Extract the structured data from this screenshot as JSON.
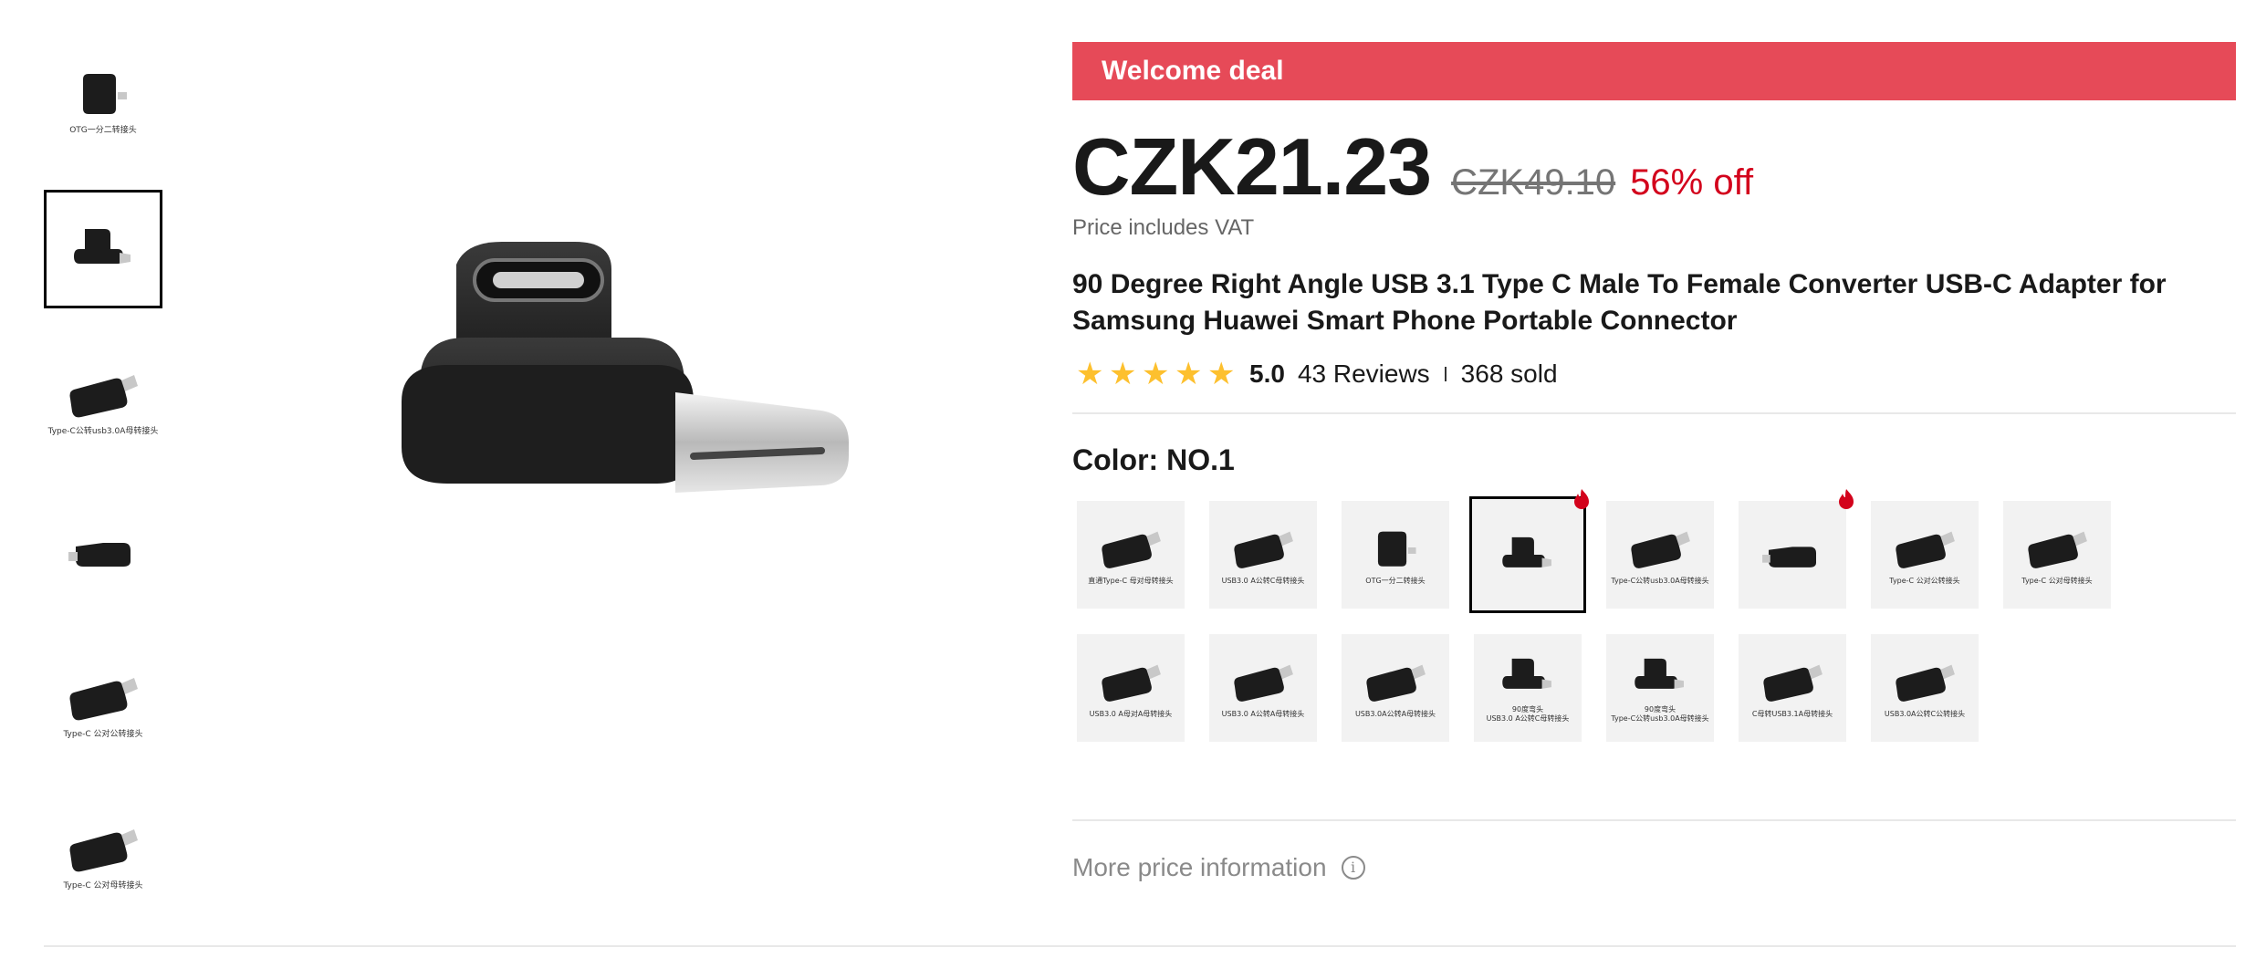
{
  "thumbnails": [
    {
      "caption": "OTG一分二转接头",
      "icon": "otg-splitter-adapter"
    },
    {
      "caption": "",
      "icon": "right-angle-type-c-adapter"
    },
    {
      "caption": "Type-C公转usb3.0A母转接头",
      "icon": "usb-a-female-adapter"
    },
    {
      "caption": "",
      "icon": "side-angle-adapter"
    },
    {
      "caption": "Type-C 公对公转接头",
      "icon": "type-c-male-male-adapter"
    },
    {
      "caption": "Type-C 公对母转接头",
      "icon": "type-c-male-female-adapter"
    }
  ],
  "active_thumbnail": 1,
  "deal": {
    "label": "Welcome deal",
    "color": "#e64a58"
  },
  "price": {
    "current": "CZK21.23",
    "original": "CZK49.10",
    "discount": "56% off",
    "vat_note": "Price includes VAT"
  },
  "product": {
    "title": "90 Degree Right Angle USB 3.1 Type C Male To Female Converter USB-C Adapter for Samsung Huawei Smart Phone Portable Connector"
  },
  "rating": {
    "stars": 5,
    "value": "5.0",
    "reviews": "43 Reviews",
    "sold": "368 sold"
  },
  "color": {
    "label": "Color: NO.1",
    "selected_index": 3,
    "options": [
      {
        "caption": "直通Type-C 母对母转接头",
        "hot": false
      },
      {
        "caption": "USB3.0 A公转C母转接头",
        "hot": false
      },
      {
        "caption": "OTG一分二转接头",
        "hot": false
      },
      {
        "caption": "",
        "hot": true
      },
      {
        "caption": "Type-C公转usb3.0A母转接头",
        "hot": false
      },
      {
        "caption": "",
        "hot": true
      },
      {
        "caption": "Type-C 公对公转接头",
        "hot": false
      },
      {
        "caption": "Type-C 公对母转接头",
        "hot": false
      },
      {
        "caption": "USB3.0 A母对A母转接头",
        "hot": false
      },
      {
        "caption": "USB3.0 A公转A母转接头",
        "hot": false
      },
      {
        "caption": "USB3.0A公转A母转接头",
        "hot": false
      },
      {
        "caption": "90度弯头\nUSB3.0 A公转C母转接头",
        "hot": false
      },
      {
        "caption": "90度弯头\nType-C公转usb3.0A母转接头",
        "hot": false
      },
      {
        "caption": "C母转USB3.1A母转接头",
        "hot": false
      },
      {
        "caption": "USB3.0A公转C公转接头",
        "hot": false
      }
    ]
  },
  "more_price_info": "More price information",
  "colors": {
    "accent": "#e64a58",
    "discount": "#d3031c",
    "star": "#fdc02e"
  }
}
